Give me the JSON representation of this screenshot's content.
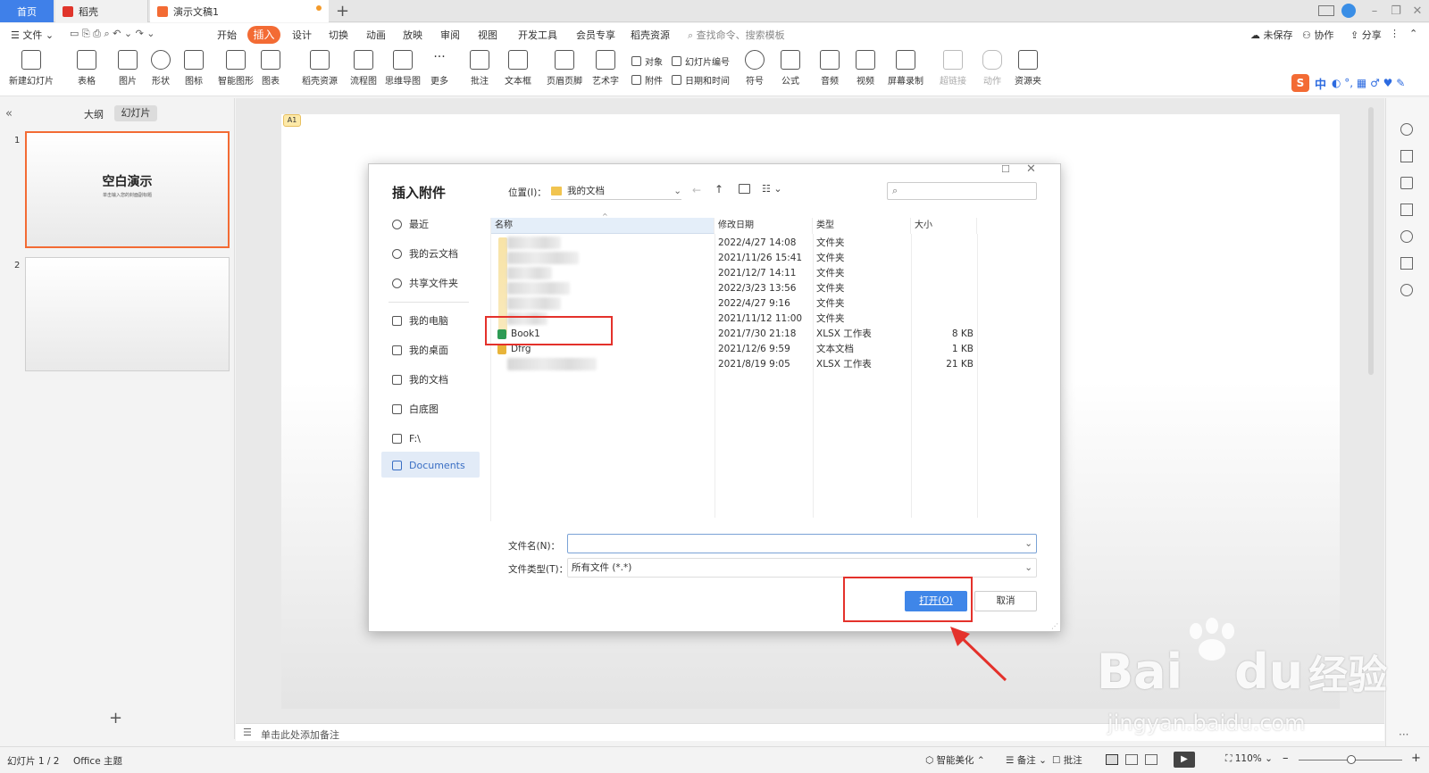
{
  "tabs": {
    "home": "首页",
    "daoke": "稻壳",
    "doc": "演示文稿1"
  },
  "menubar": {
    "file": "文件",
    "items": [
      "开始",
      "插入",
      "设计",
      "切换",
      "动画",
      "放映",
      "审阅",
      "视图",
      "开发工具",
      "会员专享",
      "稻壳资源"
    ],
    "search": "查找命令、搜索模板",
    "unsaved": "未保存",
    "collab": "协作",
    "share": "分享"
  },
  "ribbon": {
    "new_slide": "新建幻灯片",
    "table": "表格",
    "picture": "图片",
    "shape": "形状",
    "icon": "图标",
    "smart": "智能图形",
    "chart": "图表",
    "daoke_res": "稻壳资源",
    "flow": "流程图",
    "mind": "思维导图",
    "more": "更多",
    "comment": "批注",
    "textbox": "文本框",
    "header": "页眉页脚",
    "art": "艺术字",
    "object": "对象",
    "slide_no": "幻灯片编号",
    "attach": "附件",
    "datetime": "日期和时间",
    "symbol": "符号",
    "formula": "公式",
    "audio": "音频",
    "video": "视频",
    "screenrec": "屏幕录制",
    "link": "超链接",
    "action": "动作",
    "resource": "资源夹"
  },
  "ime": {
    "zh": "中"
  },
  "leftpanel": {
    "outline": "大纲",
    "slides": "幻灯片",
    "slide1_title": "空白演示",
    "slide1_sub": "单击输入您的封面副标题",
    "num1": "1",
    "num2": "2"
  },
  "slide": {
    "badge": "A1"
  },
  "notes": {
    "placeholder": "单击此处添加备注"
  },
  "status": {
    "slide_index": "幻灯片 1 / 2",
    "theme": "Office 主题",
    "beautify": "智能美化",
    "notes": "备注",
    "comment": "批注",
    "zoom": "110%"
  },
  "dialog": {
    "title": "插入附件",
    "location_label": "位置(I)：",
    "location_value": "我的文档",
    "nav": [
      "最近",
      "我的云文档",
      "共享文件夹",
      "我的电脑",
      "我的桌面",
      "我的文档",
      "白底图",
      "F:\\",
      "Documents"
    ],
    "columns": [
      "名称",
      "修改日期",
      "类型",
      "大小"
    ],
    "rows": [
      {
        "name": "",
        "date": "2022/4/27 14:08",
        "type": "文件夹",
        "size": ""
      },
      {
        "name": "",
        "date": "2021/11/26 15:41",
        "type": "文件夹",
        "size": ""
      },
      {
        "name": "",
        "date": "2021/12/7 14:11",
        "type": "文件夹",
        "size": ""
      },
      {
        "name": "",
        "date": "2022/3/23 13:56",
        "type": "文件夹",
        "size": ""
      },
      {
        "name": "",
        "date": "2022/4/27 9:16",
        "type": "文件夹",
        "size": ""
      },
      {
        "name": "",
        "date": "2021/11/12 11:00",
        "type": "文件夹",
        "size": ""
      },
      {
        "name": "Book1",
        "date": "2021/7/30 21:18",
        "type": "XLSX 工作表",
        "size": "8 KB"
      },
      {
        "name": "Dfrg",
        "date": "2021/12/6 9:59",
        "type": "文本文档",
        "size": "1 KB"
      },
      {
        "name": "",
        "date": "2021/8/19 9:05",
        "type": "XLSX 工作表",
        "size": "21 KB"
      }
    ],
    "filename_label": "文件名(N)：",
    "filename_value": "",
    "filetype_label": "文件类型(T)：",
    "filetype_value": "所有文件 (*.*)",
    "open_button": "打开(O)",
    "cancel_button": "取消"
  },
  "watermark": {
    "brand": "Bai",
    "brand2": "du",
    "cn": "经验",
    "url": "jingyan.baidu.com"
  },
  "colors": {
    "accent": "#f36b34",
    "blue": "#3f80e9",
    "highlight": "#e4312b"
  }
}
